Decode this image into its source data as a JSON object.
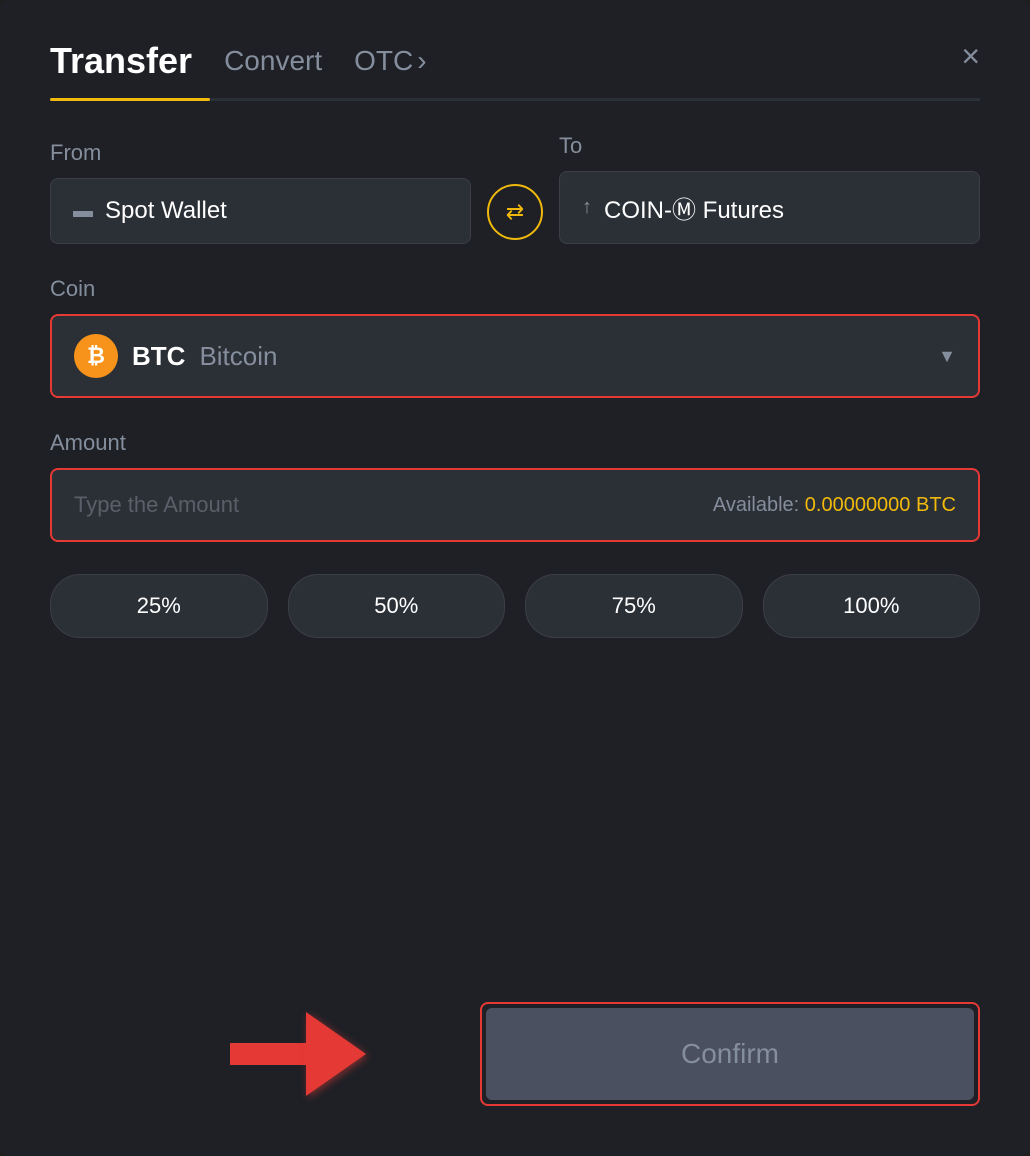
{
  "modal": {
    "title": "Transfer",
    "tabs": [
      {
        "label": "Transfer",
        "active": true
      },
      {
        "label": "Convert",
        "active": false
      },
      {
        "label": "OTC",
        "active": false
      }
    ],
    "otc_chevron": "›",
    "close_label": "×"
  },
  "from": {
    "label": "From",
    "wallet_icon": "▬",
    "wallet_name": "Spot Wallet"
  },
  "swap": {
    "icon": "⇄"
  },
  "to": {
    "label": "To",
    "wallet_icon": "↑",
    "wallet_name": "COIN-Ⓜ Futures"
  },
  "coin": {
    "label": "Coin",
    "symbol": "BTC",
    "name": "Bitcoin",
    "chevron": "▼"
  },
  "amount": {
    "label": "Amount",
    "placeholder": "Type the Amount",
    "available_label": "Available:",
    "available_value": "0.00000000",
    "available_unit": "BTC"
  },
  "percentages": [
    {
      "label": "25%"
    },
    {
      "label": "50%"
    },
    {
      "label": "75%"
    },
    {
      "label": "100%"
    }
  ],
  "confirm": {
    "label": "Confirm"
  }
}
